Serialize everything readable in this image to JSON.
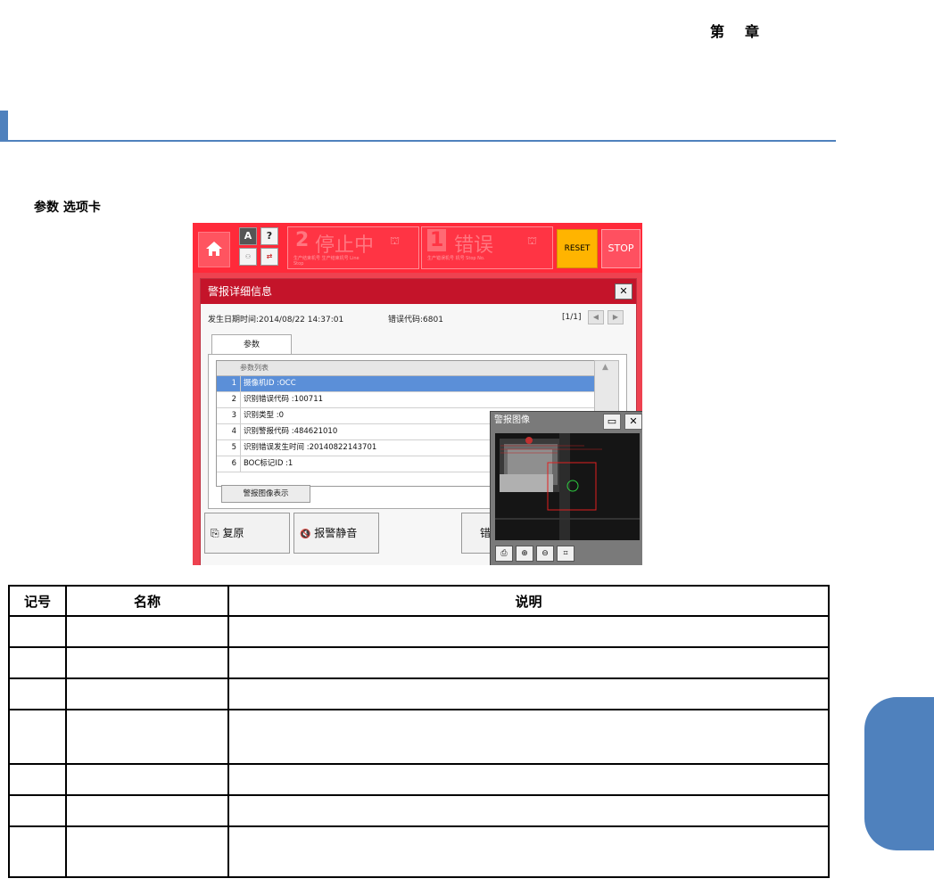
{
  "header": {
    "chapter_label_1": "第",
    "chapter_label_2": "章"
  },
  "section": {
    "subheading": "参数 选项卡"
  },
  "screenshot": {
    "topbar": {
      "status_1_number": "2",
      "status_1_text": "停止中",
      "status_1_sub": "生产结束机号 生产结束机号 Line Stop",
      "status_2_number": "1",
      "status_2_text": "错误",
      "status_2_sub": "生产错误机号 机号 Stop No.",
      "help_label": "?",
      "reset_label": "RESET",
      "stop_label": "STOP"
    },
    "dialog": {
      "title": "警报详细信息",
      "close_label": "✕",
      "occurred_label": "发生日期时间:2014/08/22 14:37:01",
      "error_code_label": "错误代码:6801",
      "page_indicator": "[1/1]",
      "tab_label": "参数",
      "list_header": "参数列表",
      "rows": [
        {
          "no": "1",
          "text": "摄像机ID :OCC"
        },
        {
          "no": "2",
          "text": "识别错误代码 :100711"
        },
        {
          "no": "3",
          "text": "识别类型 :0"
        },
        {
          "no": "4",
          "text": "识别警报代码 :484621010"
        },
        {
          "no": "5",
          "text": "识别错误发生时间 :20140822143701"
        },
        {
          "no": "6",
          "text": "BOC标记ID :1"
        }
      ],
      "show_image_button": "警报图像表示",
      "restore_button": "复原",
      "mute_button": "报警静音",
      "error_button_partial": "错"
    },
    "image_window": {
      "title": "警报图像",
      "close_label": "✕"
    }
  },
  "table": {
    "headers": [
      "记号",
      "名称",
      "说明"
    ],
    "row_count": 7
  },
  "colors": {
    "accent_blue": "#4f81bd",
    "alarm_red": "#ff2a3a",
    "reset_yellow": "#ffb400",
    "selected_row": "#5b8fd8"
  }
}
